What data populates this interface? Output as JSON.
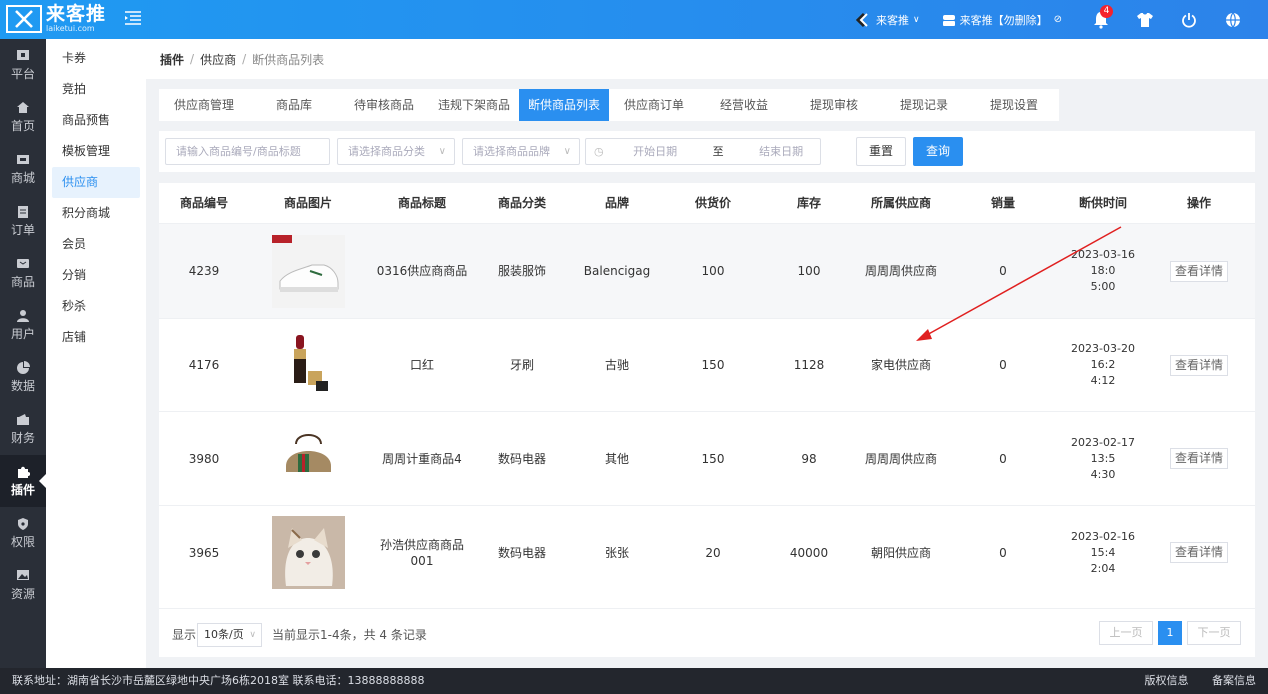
{
  "brand": {
    "name_cn": "来客推",
    "name_en": "laiketui.com"
  },
  "topbar": {
    "store_label": "来客推",
    "user_label": "来客推【勿删除】",
    "notification_count": "4"
  },
  "iconnav": [
    {
      "label": "平台",
      "icon": "platform-icon"
    },
    {
      "label": "首页",
      "icon": "home-icon"
    },
    {
      "label": "商城",
      "icon": "mall-icon"
    },
    {
      "label": "订单",
      "icon": "order-icon"
    },
    {
      "label": "商品",
      "icon": "goods-icon"
    },
    {
      "label": "用户",
      "icon": "user-icon"
    },
    {
      "label": "数据",
      "icon": "data-icon"
    },
    {
      "label": "财务",
      "icon": "finance-icon"
    },
    {
      "label": "插件",
      "icon": "plugin-icon"
    },
    {
      "label": "权限",
      "icon": "permission-icon"
    },
    {
      "label": "资源",
      "icon": "resource-icon"
    }
  ],
  "submenu": [
    "卡券",
    "竞拍",
    "商品预售",
    "模板管理",
    "供应商",
    "积分商城",
    "会员",
    "分销",
    "秒杀",
    "店铺"
  ],
  "breadcrumb": {
    "first": "插件",
    "second": "供应商",
    "current": "断供商品列表"
  },
  "tabs": [
    "供应商管理",
    "商品库",
    "待审核商品",
    "违规下架商品",
    "断供商品列表",
    "供应商订单",
    "经营收益",
    "提现审核",
    "提现记录",
    "提现设置"
  ],
  "filter": {
    "keyword_placeholder": "请输入商品编号/商品标题",
    "category_placeholder": "请选择商品分类",
    "brand_placeholder": "请选择商品品牌",
    "start_placeholder": "开始日期",
    "to_label": "至",
    "end_placeholder": "结束日期",
    "reset_label": "重置",
    "query_label": "查询"
  },
  "table": {
    "headers": [
      "商品编号",
      "商品图片",
      "商品标题",
      "商品分类",
      "品牌",
      "供货价",
      "库存",
      "所属供应商",
      "销量",
      "断供时间",
      "操作"
    ],
    "rows": [
      {
        "id": "4239",
        "image": "sneaker-image",
        "title": "0316供应商商品",
        "category": "服装服饰",
        "brand": "Balencigag",
        "price": "100",
        "stock": "100",
        "supplier": "周周周供应商",
        "sales": "0",
        "time_1": "2023-03-16 18:0",
        "time_2": "5:00",
        "action": "查看详情"
      },
      {
        "id": "4176",
        "image": "lipstick-image",
        "title": "口红",
        "category": "牙刷",
        "brand": "古驰",
        "price": "150",
        "stock": "1128",
        "supplier": "家电供应商",
        "sales": "0",
        "time_1": "2023-03-20 16:2",
        "time_2": "4:12",
        "action": "查看详情"
      },
      {
        "id": "3980",
        "image": "handbag-image",
        "title": "周周计重商品4",
        "category": "数码电器",
        "brand": "其他",
        "price": "150",
        "stock": "98",
        "supplier": "周周周供应商",
        "sales": "0",
        "time_1": "2023-02-17 13:5",
        "time_2": "4:30",
        "action": "查看详情"
      },
      {
        "id": "3965",
        "image": "cat-image",
        "title_1": "孙浩供应商商品",
        "title_2": "001",
        "category": "数码电器",
        "brand": "张张",
        "price": "20",
        "stock": "40000",
        "supplier": "朝阳供应商",
        "sales": "0",
        "time_1": "2023-02-16 15:4",
        "time_2": "2:04",
        "action": "查看详情"
      }
    ]
  },
  "pager": {
    "show_label": "显示",
    "page_size": "10条/页",
    "range_text": "当前显示1-4条，共 4 条记录",
    "prev_label": "上一页",
    "current_page": "1",
    "next_label": "下一页"
  },
  "footer": {
    "address": "联系地址：湖南省长沙市岳麓区绿地中央广场6栋2018室 联系电话：13888888888",
    "copyright": "版权信息",
    "record": "备案信息"
  },
  "colors": {
    "primary": "#2a8ff0",
    "topbar": "#1f9af2",
    "nav_dark": "#2a2f38",
    "annotation_arrow": "#e02020"
  }
}
